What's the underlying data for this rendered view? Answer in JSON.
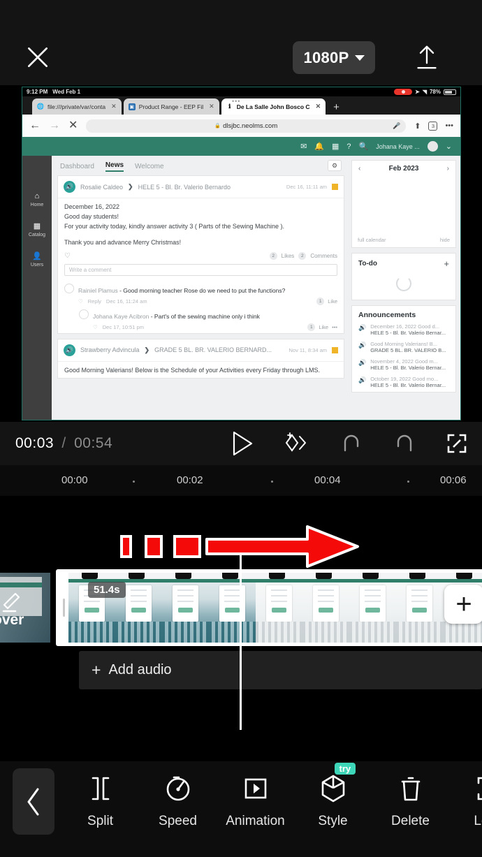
{
  "topbar": {
    "close_icon": "close-icon",
    "resolution": "1080P",
    "export_icon": "upload-icon"
  },
  "preview": {
    "ios_status": {
      "time": "9:12 PM",
      "date": "Wed Feb 1",
      "battery": "78%"
    },
    "browser": {
      "tabs": [
        {
          "title": "file:///private/var/conta",
          "favicon": "globe-icon",
          "active": false
        },
        {
          "title": "Product Range - EEP Fil",
          "favicon": "app-icon",
          "active": false
        },
        {
          "title": "De La Salle John Bosco C",
          "favicon": "info-icon",
          "active": true
        }
      ],
      "new_tab_label": "+",
      "url": "dlsjbc.neolms.com",
      "tab_count": "3"
    },
    "lms": {
      "user": "Johana Kaye ...",
      "sidebar": [
        {
          "icon": "home-icon",
          "label": "Home"
        },
        {
          "icon": "grid-icon",
          "label": "Catalog"
        },
        {
          "icon": "user-icon",
          "label": "Users"
        }
      ],
      "tabs": [
        {
          "label": "Dashboard",
          "active": false
        },
        {
          "label": "News",
          "active": true
        },
        {
          "label": "Welcome",
          "active": false
        }
      ],
      "posts": [
        {
          "author": "Rosalie Caldeo",
          "course": "HELE 5 - Bl. Br. Valerio Bernardo",
          "date": "Dec 16, 11:11 am",
          "body_lines": [
            "December 16, 2022",
            "Good day students!",
            "For your activity today, kindly answer activity 3 ( Parts of the Sewing Machine ).",
            "",
            "Thank you and advance Merry Christmas!"
          ],
          "likes": "2",
          "likes_label": "Likes",
          "comments": "2",
          "comments_label": "Comments",
          "comment_placeholder": "Write a comment",
          "comments_list": [
            {
              "name": "Rainiel Plamus",
              "text": "Good morning teacher Rose do we need to put the functions?",
              "reply_label": "Reply",
              "date": "Dec 16, 11:24 am",
              "like_count": "1",
              "like_label": "Like",
              "nested": false
            },
            {
              "name": "Johana Kaye Acibron",
              "text": "Part's of the sewing machine only i think",
              "reply_label": "",
              "date": "Dec 17, 10:51 pm",
              "like_count": "1",
              "like_label": "Like",
              "nested": true
            }
          ]
        },
        {
          "author": "Strawberry Advincula",
          "course": "GRADE 5 BL. BR. VALERIO BERNARD...",
          "date": "Nov 11, 8:34 am",
          "body_lines": [
            "Good Morning Valerians! Below is the Schedule of your Activities every Friday through LMS."
          ]
        }
      ],
      "calendar": {
        "month": "Feb 2023",
        "prev": "‹",
        "next": "›",
        "full_link": "full calendar",
        "hide_link": "hide"
      },
      "todo": {
        "title": "To-do",
        "add": "+"
      },
      "announcements": {
        "title": "Announcements",
        "items": [
          {
            "line1": "December 16, 2022 Good d...",
            "line2": "HELE 5 - Bl. Br. Valerio Bernar..."
          },
          {
            "line1": "Good Morning Valerians! B...",
            "line2": "GRADE 5 BL. BR. VALERIO B..."
          },
          {
            "line1": "November 4, 2022 Good m...",
            "line2": "HELE 5 - Bl. Br. Valerio Bernar..."
          },
          {
            "line1": "October 19, 2022 Good mo...",
            "line2": "HELE 5 - Bl. Br. Valerio Bernar..."
          }
        ]
      }
    }
  },
  "player": {
    "current_time": "00:03",
    "separator": "/",
    "total_time": "00:54",
    "play_icon": "play-icon",
    "keyframe_icon": "add-keyframe-icon",
    "undo_icon": "undo-icon",
    "redo_icon": "redo-icon",
    "fullscreen_icon": "fullscreen-icon"
  },
  "ruler": {
    "labels": [
      "00:00",
      "00:02",
      "00:04",
      "00:06"
    ]
  },
  "timeline": {
    "cover_label": "over",
    "cover_icon": "pencil-icon",
    "clip_duration": "51.4s",
    "add_clip_label": "+",
    "audio_track_label": "Add audio",
    "audio_track_plus": "+"
  },
  "toolbar": {
    "back_icon": "chevron-left-icon",
    "tools": [
      {
        "label": "Split",
        "icon": "split-icon",
        "badge": ""
      },
      {
        "label": "Speed",
        "icon": "speed-icon",
        "badge": ""
      },
      {
        "label": "Animation",
        "icon": "animation-icon",
        "badge": ""
      },
      {
        "label": "Style",
        "icon": "style-cube-icon",
        "badge": "try"
      },
      {
        "label": "Delete",
        "icon": "trash-icon",
        "badge": ""
      },
      {
        "label": "Lock",
        "icon": "lock-icon",
        "badge": ""
      }
    ]
  },
  "colors": {
    "background": "#000000",
    "panel": "#141414",
    "accent_teal": "#3ed6b8",
    "annotation_red": "#f50a0a",
    "lms_green": "#2f7f6b"
  }
}
